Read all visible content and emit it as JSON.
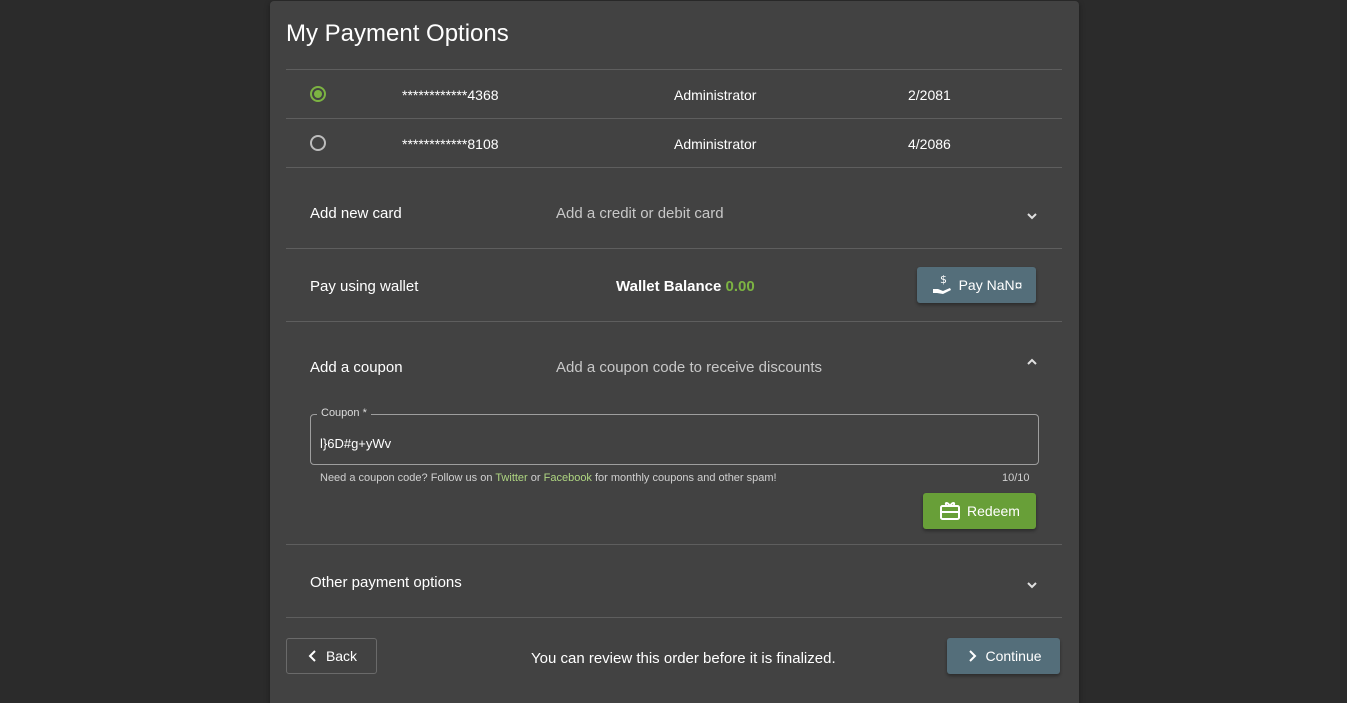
{
  "title": "My Payment Options",
  "cards": [
    {
      "number": "************4368",
      "holder": "Administrator",
      "expiry": "2/2081",
      "selected": true
    },
    {
      "number": "************8108",
      "holder": "Administrator",
      "expiry": "4/2086",
      "selected": false
    }
  ],
  "add_card": {
    "title": "Add new card",
    "subtitle": "Add a credit or debit card"
  },
  "wallet": {
    "title": "Pay using wallet",
    "balance_label": "Wallet Balance",
    "balance_value": "0.00",
    "pay_label": "Pay NaN¤"
  },
  "coupon": {
    "title": "Add a coupon",
    "subtitle": "Add a coupon code to receive discounts",
    "field_label": "Coupon *",
    "field_value": "l}6D#g+yWv",
    "hint_prefix": "Need a coupon code? Follow us on",
    "hint_twitter": "Twitter",
    "hint_or": "or",
    "hint_facebook": "Facebook",
    "hint_suffix": "for monthly coupons and other spam!",
    "counter": "10/10",
    "redeem_label": "Redeem"
  },
  "other": {
    "title": "Other payment options"
  },
  "footer": {
    "back_label": "Back",
    "review_text": "You can review this order before it is finalized.",
    "continue_label": "Continue"
  },
  "colors": {
    "accent_green": "#7cb342",
    "slate_button": "#546e7a",
    "redeem_button": "#689f38"
  }
}
